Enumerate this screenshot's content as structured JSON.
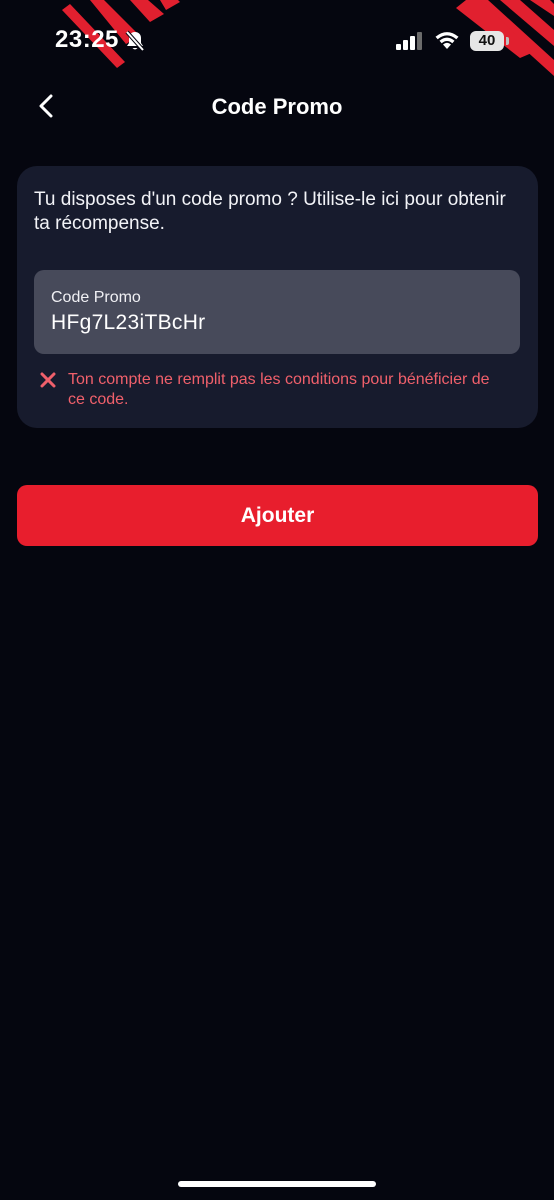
{
  "status_bar": {
    "time": "23:25",
    "battery": "40"
  },
  "header": {
    "title": "Code Promo"
  },
  "promo_card": {
    "intro_text": "Tu disposes d'un code promo ? Utilise-le ici pour obtenir ta récompense.",
    "field_label": "Code Promo",
    "field_value": "HFg7L23iTBcHr",
    "error_message": "Ton compte ne remplit pas les conditions pour bénéficier de ce code."
  },
  "actions": {
    "add_label": "Ajouter"
  },
  "colors": {
    "background": "#05060f",
    "card": "#171b2d",
    "accent": "#e81e2d",
    "error": "#f0606b"
  },
  "icons": {
    "back": "chevron-left-icon",
    "error": "close-icon",
    "bell": "bell-slash-icon"
  }
}
